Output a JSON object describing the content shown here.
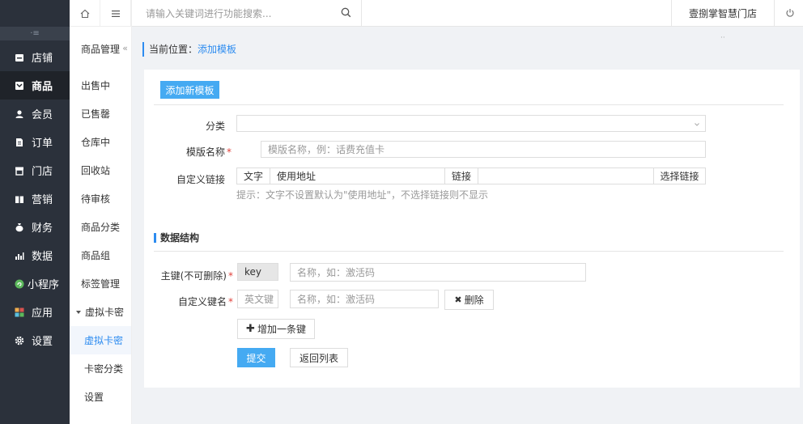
{
  "topbar": {
    "search_placeholder": "请输入关键词进行功能搜索...",
    "store_name": "壹捌掌智慧门店"
  },
  "sidebar": {
    "collapse_label": "·≡",
    "items": [
      {
        "label": "店铺",
        "icon": "shop-icon"
      },
      {
        "label": "商品",
        "icon": "goods-icon"
      },
      {
        "label": "会员",
        "icon": "member-icon"
      },
      {
        "label": "订单",
        "icon": "order-icon"
      },
      {
        "label": "门店",
        "icon": "store-icon"
      },
      {
        "label": "营销",
        "icon": "marketing-icon"
      },
      {
        "label": "财务",
        "icon": "finance-icon"
      },
      {
        "label": "数据",
        "icon": "data-icon"
      },
      {
        "label": "小程序",
        "icon": "miniapp-icon"
      },
      {
        "label": "应用",
        "icon": "apps-icon"
      },
      {
        "label": "设置",
        "icon": "settings-icon"
      }
    ]
  },
  "subnav": {
    "title": "商品管理",
    "items": [
      "出售中",
      "已售罄",
      "仓库中",
      "回收站",
      "待审核",
      "商品分类",
      "商品组",
      "标签管理"
    ],
    "group": "虚拟卡密",
    "group_items": [
      "虚拟卡密",
      "卡密分类",
      "设置"
    ]
  },
  "breadcrumb": {
    "prefix": "当前位置：",
    "current": "添加模板"
  },
  "form": {
    "add_button": "添加新模板",
    "category_label": "分类",
    "category_value": "",
    "name_label": "模版名称",
    "name_placeholder": "模版名称，例：话费充值卡",
    "link_label": "自定义链接",
    "text_addon": "文字",
    "text_value": "使用地址",
    "link_addon": "链接",
    "link_value": "",
    "select_link_button": "选择链接",
    "hint": "提示：文字不设置默认为\"使用地址\"，不选择链接则不显示"
  },
  "data_structure": {
    "title": "数据结构",
    "primary_key_label": "主键(不可删除)",
    "primary_key_value": "key",
    "primary_key_name_placeholder": "名称，如：激活码",
    "custom_key_label": "自定义键名",
    "custom_key_placeholder": "英文键",
    "custom_key_name_placeholder": "名称，如：激活码",
    "delete_button": "删除",
    "add_key_button": "增加一条键",
    "submit_button": "提交",
    "back_button": "返回列表"
  },
  "colors": {
    "sidebar_bg": "#2b313b",
    "accent": "#2d8cf0",
    "primary_button": "#45aaf2",
    "required": "#e0403a"
  }
}
